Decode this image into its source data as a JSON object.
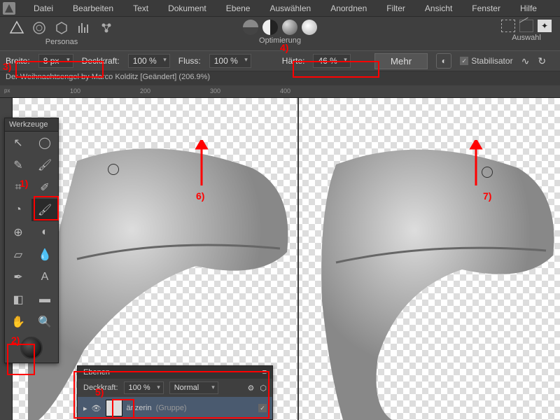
{
  "menu": [
    "Datei",
    "Bearbeiten",
    "Text",
    "Dokument",
    "Ebene",
    "Auswählen",
    "Anordnen",
    "Filter",
    "Ansicht",
    "Fenster",
    "Hilfe"
  ],
  "personas": {
    "label": "Personas"
  },
  "optimization": {
    "label": "Optimierung"
  },
  "selection": {
    "label": "Auswahl"
  },
  "context": {
    "width_label": "Breite:",
    "width_value": "8 px",
    "opacity_label": "Deckkraft:",
    "opacity_value": "100 %",
    "flow_label": "Fluss:",
    "flow_value": "100 %",
    "hardness_label": "Härte:",
    "hardness_value": "46 %",
    "more": "Mehr",
    "stabilizer": "Stabilisator"
  },
  "document_title": "Der Weihnachtsengel by Marco Kolditz [Geändert] (206.9%)",
  "ruler": {
    "m100": "100",
    "m200": "200",
    "m300": "300",
    "m400": "400"
  },
  "toolbox": {
    "title": "Werkzeuge"
  },
  "layers": {
    "tab": "Ebenen",
    "opacity_label": "Deckkraft:",
    "opacity_value": "100 %",
    "blend": "Normal",
    "layer_name": "änzerin",
    "layer_group": "(Gruppe)"
  },
  "annotations": {
    "a1": "1)",
    "a2": "2)",
    "a3": "3)",
    "a4": "4)",
    "a5": "5)",
    "a6": "6)",
    "a7": "7)"
  }
}
